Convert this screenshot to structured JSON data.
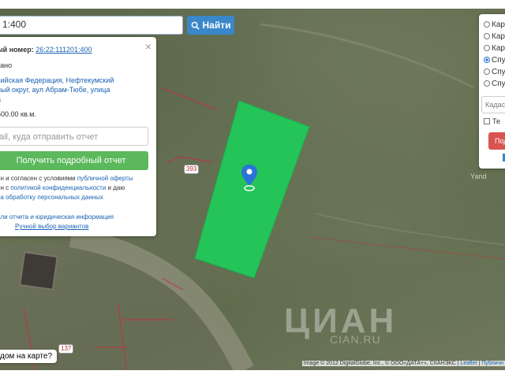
{
  "search": {
    "value": "1:400",
    "button_label": "Найти"
  },
  "info_panel": {
    "close_label": "×",
    "cadastral_label": "ый номер:",
    "cadastral_number": "26:22:111201:400",
    "status": "зано",
    "address_lines": [
      "сийская Федерация, Нефтекумский",
      "ный округ, аул Абрам-Тюбе, улица",
      "а"
    ],
    "area": "500.00 кв.м.",
    "email_placeholder": "ail, куда отправить отчет",
    "report_button": "Получить подробный отчет",
    "consent_lines": [
      {
        "pre": "ен и согласен с условиями ",
        "link": "публичной оферты",
        "post": ""
      },
      {
        "pre": "ен с ",
        "link": "политикой конфиденциальности",
        "post": " и даю"
      },
      {
        "pre": "",
        "link": "на обработку персональных данных",
        "post": ""
      }
    ],
    "details_link": "али отчета и юридическая информация",
    "manual_link": "Ручной выбор вариантов"
  },
  "right_panel": {
    "layers": [
      {
        "label": "Кар",
        "selected": false
      },
      {
        "label": "Кар",
        "selected": false
      },
      {
        "label": "Кар",
        "selected": false
      },
      {
        "label": "Спу",
        "selected": true
      },
      {
        "label": "Спу",
        "selected": false
      },
      {
        "label": "Спу",
        "selected": false
      }
    ],
    "input_text": "Кадаст",
    "checkbox_label": "Те",
    "button_label": "Под"
  },
  "map": {
    "road_labels": [
      "393",
      "137"
    ],
    "question_bubble": "дом на карте?",
    "yandex_label": "Yand",
    "watermark": "ЦИАН",
    "watermark_sub": "CIAN.RU",
    "attribution": "Image © 2012 DigitalGlobe, Inc., © OOO«ДАТА+», СКАНЭКС",
    "leaflet_label": "Leaflet",
    "pub_label": "Публичн"
  },
  "colors": {
    "plot_fill": "#1fcc5a",
    "button_blue": "#3a87c9",
    "button_green": "#5cb85c",
    "button_red": "#d9534f",
    "boundary": "#c0333a"
  }
}
